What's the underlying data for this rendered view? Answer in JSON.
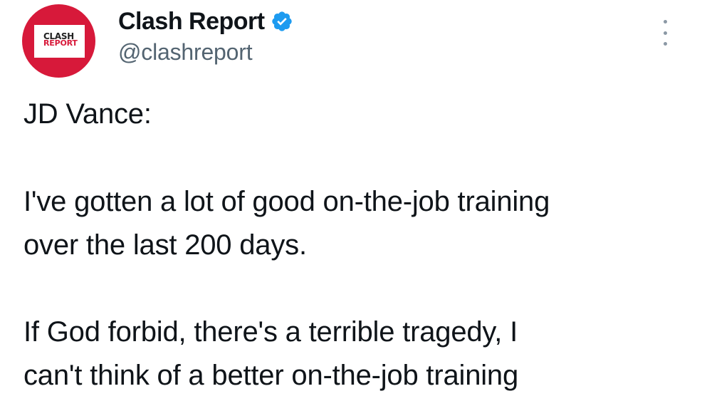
{
  "tweet": {
    "avatar": {
      "logo_line1": "CLASH",
      "logo_line2": "REPORT",
      "brand_color": "#d7193a"
    },
    "author": {
      "display_name": "Clash Report",
      "handle": "@clashreport",
      "verified_icon": "verified-badge-icon",
      "verified_color": "#1d9bf0"
    },
    "more_icon": "more-options-icon",
    "lines": [
      "JD Vance:",
      "I've gotten a lot of good on-the-job training",
      "over the last 200 days.",
      "If God forbid, there's a terrible tragedy, I",
      "can't think of a better on-the-job training"
    ]
  }
}
